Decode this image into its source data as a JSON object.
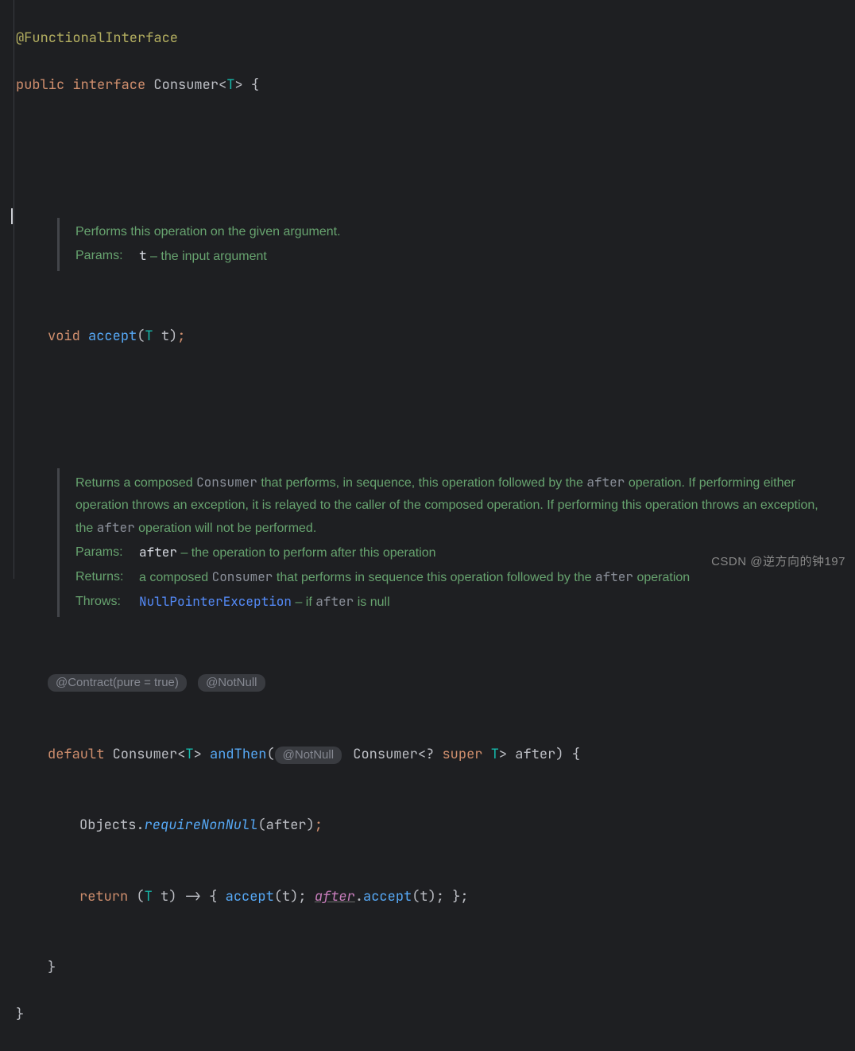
{
  "annotation": "@FunctionalInterface",
  "decl": {
    "kw_public": "public",
    "kw_interface": "interface",
    "name": "Consumer",
    "generic_open": "<",
    "generic_T": "T",
    "generic_close": ">",
    "brace_open": "{"
  },
  "doc1": {
    "line": "Performs this operation on the given argument.",
    "params_tag": "Params:",
    "param_name": "t",
    "param_rest": " – the input argument"
  },
  "accept": {
    "kw_void": "void",
    "name": "accept",
    "open": "(",
    "T": "T",
    "sp": " ",
    "arg": "t",
    "close": ")",
    "semi": ";"
  },
  "doc2": {
    "p1a": "Returns a composed ",
    "p1code1": "Consumer",
    "p1b": " that performs, in sequence, this operation followed by the ",
    "p1code2": "after",
    "p1c": " operation. If performing either operation throws an exception, it is relayed to the caller of the composed operation. If performing this operation throws an exception, the ",
    "p1code3": "after",
    "p1d": " operation will not be performed.",
    "params_tag": "Params:",
    "param_name": "after",
    "param_rest": " – the operation to perform after this operation",
    "returns_tag": "Returns:",
    "returns_a": "a composed ",
    "returns_code1": "Consumer",
    "returns_b": " that performs in sequence this operation followed by the ",
    "returns_code2": "after",
    "returns_c": " operation",
    "throws_tag": "Throws:",
    "throws_link": "NullPointerException",
    "throws_rest_a": " – if ",
    "throws_code": "after",
    "throws_rest_b": " is null"
  },
  "pills": {
    "contract": "@Contract(pure = true)",
    "notnull": "@NotNull",
    "paramNotNull": "@NotNull"
  },
  "andthen": {
    "kw_default": "default",
    "ret": "Consumer",
    "ret_open": "<",
    "ret_T": "T",
    "ret_close": ">",
    "name": "andThen",
    "open": "(",
    "ptype": "Consumer",
    "popen": "<",
    "pq": "?",
    "kw_super": "super",
    "pT": "T",
    "pclose": ">",
    "pname": "after",
    "close": ")",
    "brace": " {"
  },
  "body": {
    "l1_obj": "Objects",
    "l1_dot": ".",
    "l1_method": "requireNonNull",
    "l1_open": "(",
    "l1_arg": "after",
    "l1_close": ")",
    "l1_semi": ";",
    "l2_return": "return",
    "l2_open": " (",
    "l2_T": "T",
    "l2_sp": " ",
    "l2_t": "t",
    "l2_arrow": ") -> { ",
    "l2_accept": "accept",
    "l2_p1": "(t); ",
    "l2_after": "after",
    "l2_dot": ".",
    "l2_accept2": "accept",
    "l2_p2": "(t); };"
  },
  "close1": "}",
  "close2": "}",
  "watermark": "CSDN @逆方向的钟197"
}
